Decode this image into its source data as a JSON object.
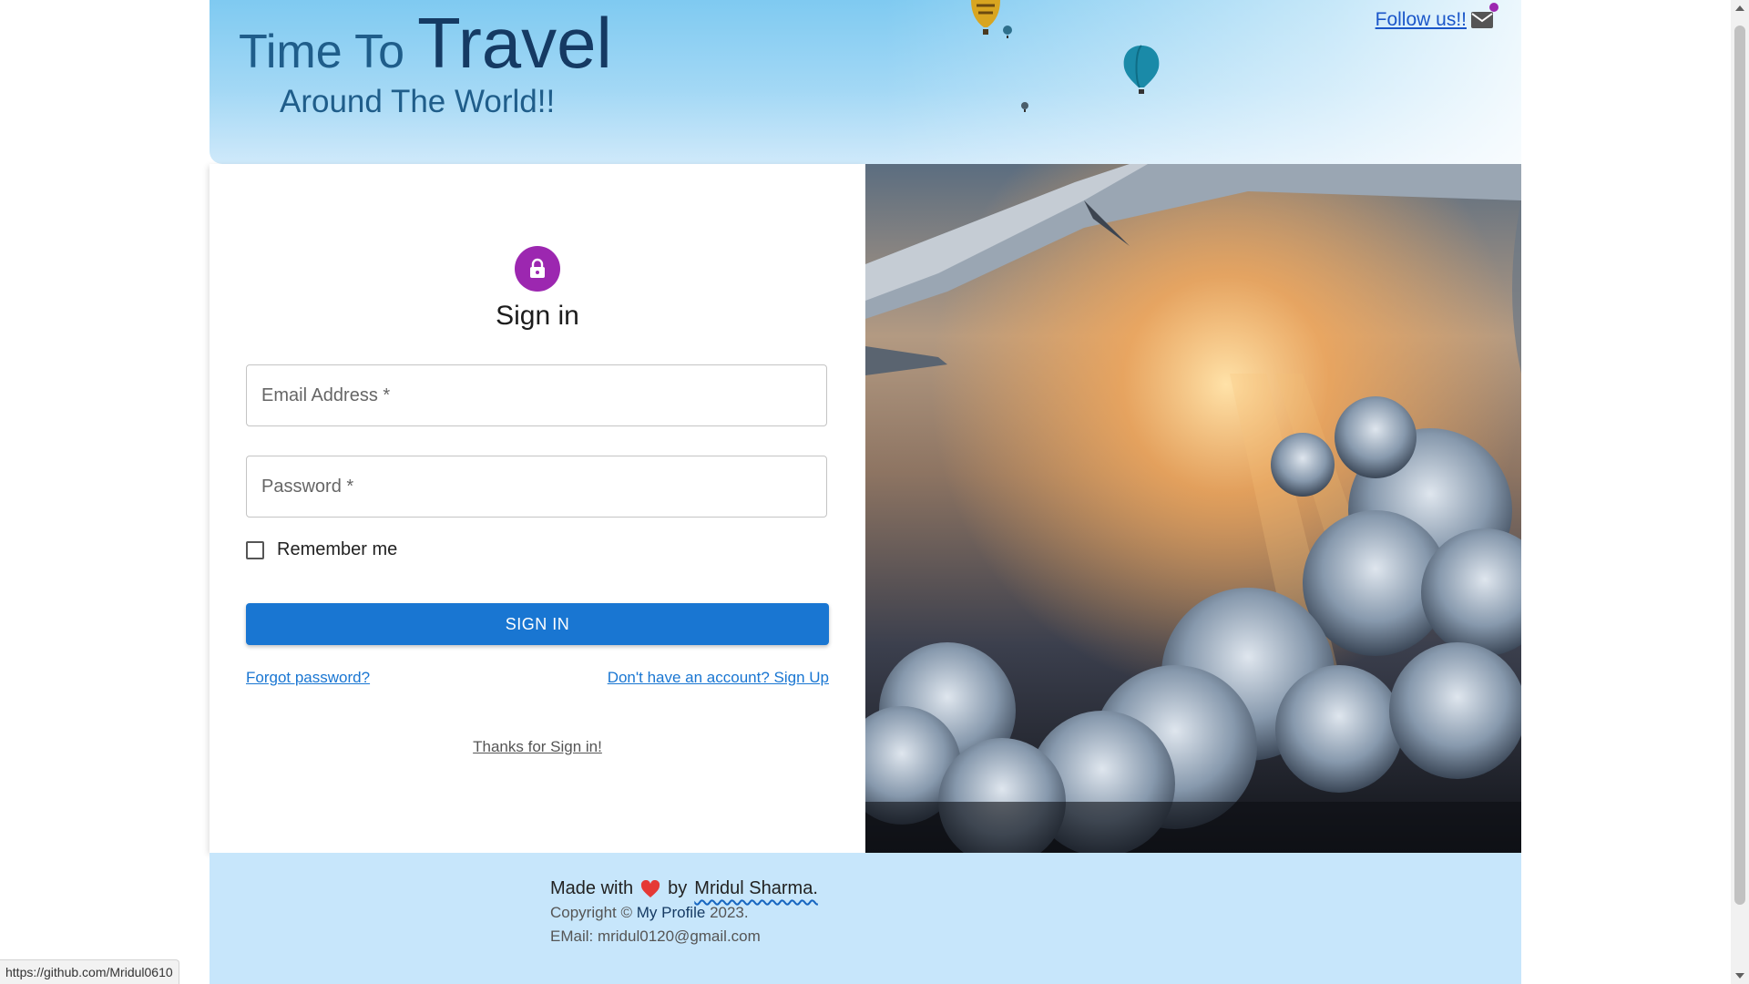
{
  "header": {
    "title_prefix": "Time To",
    "title_main": "Travel",
    "subtitle": "Around The World!!",
    "follow_label": "Follow us!!",
    "follow_icon": "mail-icon"
  },
  "signin": {
    "icon": "lock-icon",
    "title": "Sign in",
    "email_placeholder": "Email Address *",
    "password_placeholder": "Password *",
    "remember_label": "Remember me",
    "button_label": "SIGN IN",
    "forgot_link": "Forgot password?",
    "signup_link": "Don't have an account? Sign Up",
    "thanks_link": "Thanks for Sign in!"
  },
  "footer": {
    "made_with": "Made with",
    "heart_icon": "heart-icon",
    "by": "by",
    "author": "Mridul Sharma.",
    "copyright_prefix": "Copyright ©",
    "profile_link": "My Profile",
    "year": "2023.",
    "email_line": "EMail: mridul0120@gmail.com"
  },
  "status_bar": {
    "url": "https://github.com/Mridul0610"
  },
  "colors": {
    "accent": "#1976d2",
    "avatar": "#9c27b0",
    "footer_bg": "#c7e6fb"
  }
}
